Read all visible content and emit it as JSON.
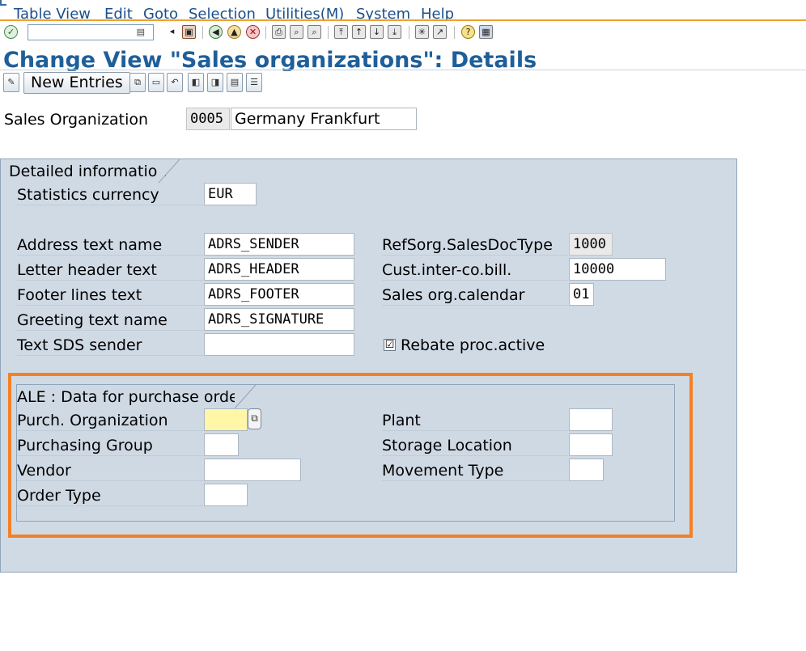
{
  "menu": [
    "Table View",
    "Edit",
    "Goto",
    "Selection",
    "Utilities(M)",
    "System",
    "Help"
  ],
  "toolbar": {
    "command_value": "",
    "icons": [
      "enter-icon",
      "back-icon",
      "save-icon",
      "exit-icon",
      "cancel-icon",
      "print-icon",
      "find-icon",
      "first-page-icon",
      "last-page-icon",
      "create-session-icon",
      "shortcut-icon",
      "help-icon",
      "layout-icon"
    ]
  },
  "page": {
    "title": "Change View \"Sales organizations\": Details"
  },
  "app_toolbar": {
    "new_entries": "New Entries"
  },
  "header": {
    "sales_org_label": "Sales Organization",
    "sales_org_code": "0005",
    "sales_org_name": "Germany Frankfurt"
  },
  "detail": {
    "group_title": "Detailed information",
    "statistics_currency_label": "Statistics currency",
    "statistics_currency_value": "EUR",
    "address_text_label": "Address text name",
    "address_text_value": "ADRS_SENDER",
    "letter_header_label": "Letter header text",
    "letter_header_value": "ADRS_HEADER",
    "footer_lines_label": "Footer lines text",
    "footer_lines_value": "ADRS_FOOTER",
    "greeting_label": "Greeting text name",
    "greeting_value": "ADRS_SIGNATURE",
    "text_sds_label": "Text SDS sender",
    "text_sds_value": "",
    "refsorg_label": "RefSorg.SalesDocType",
    "refsorg_value": "1000",
    "cust_interco_label": "Cust.inter-co.bill.",
    "cust_interco_value": "10000",
    "calendar_label": "Sales org.calendar",
    "calendar_value": "01",
    "rebate_label": "Rebate proc.active",
    "rebate_checked": true,
    "rebate_mark": "☑"
  },
  "ale": {
    "group_title": "ALE : Data for purchase order",
    "purch_org_label": "Purch. Organization",
    "purch_org_value": "",
    "purch_group_label": "Purchasing Group",
    "purch_group_value": "",
    "vendor_label": "Vendor",
    "vendor_value": "",
    "order_type_label": "Order Type",
    "order_type_value": "",
    "plant_label": "Plant",
    "plant_value": "",
    "storage_location_label": "Storage Location",
    "storage_location_value": "",
    "movement_type_label": "Movement Type",
    "movement_type_value": ""
  },
  "colors": {
    "title": "#1f5f99",
    "menu_text": "#1a4f8b",
    "group_bg": "#d0dae5",
    "highlight": "#f58024",
    "required_field": "#fff6a8"
  }
}
